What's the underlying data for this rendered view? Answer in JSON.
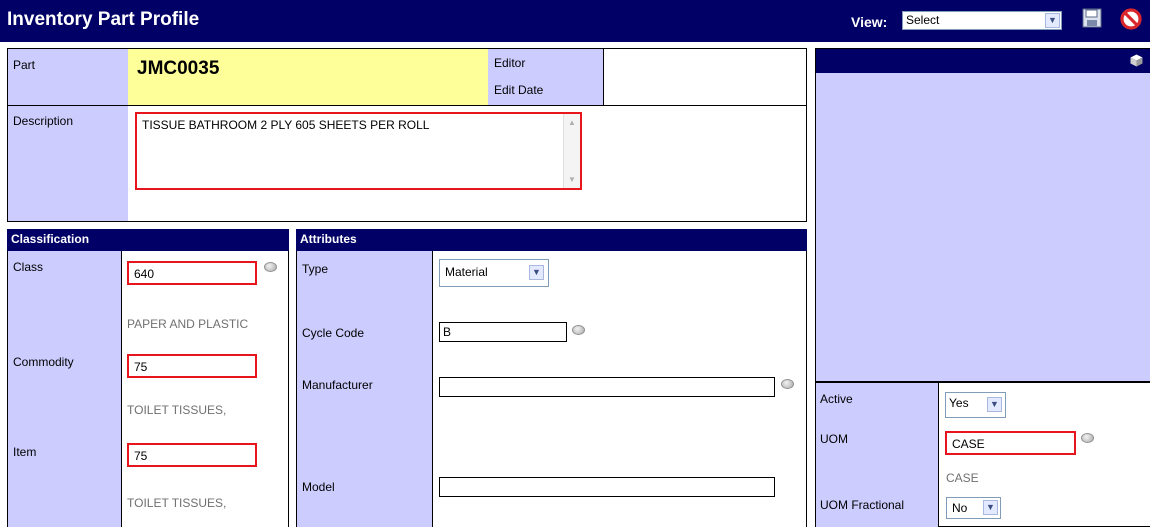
{
  "header": {
    "title": "Inventory Part Profile",
    "view_label": "View:",
    "view_value": "Select",
    "save_icon": "save-icon",
    "cancel_icon": "cancel-icon"
  },
  "part": {
    "part_label": "Part",
    "part_value": "JMC0035",
    "editor_label": "Editor",
    "edit_date_label": "Edit Date",
    "description_label": "Description",
    "description_value": "TISSUE BATHROOM 2 PLY 605 SHEETS PER ROLL"
  },
  "classification": {
    "header": "Classification",
    "class_label": "Class",
    "class_value": "640",
    "class_desc": "PAPER AND PLASTIC",
    "commodity_label": "Commodity",
    "commodity_value": "75",
    "commodity_desc": "TOILET TISSUES,",
    "item_label": "Item",
    "item_value": "75",
    "item_desc": "TOILET TISSUES,"
  },
  "attributes": {
    "header": "Attributes",
    "type_label": "Type",
    "type_value": "Material",
    "cycle_code_label": "Cycle Code",
    "cycle_code_value": "B",
    "manufacturer_label": "Manufacturer",
    "manufacturer_value": "",
    "model_label": "Model",
    "model_value": ""
  },
  "status": {
    "active_label": "Active",
    "active_value": "Yes",
    "uom_label": "UOM",
    "uom_value": "CASE",
    "uom_desc": "CASE",
    "uom_fractional_label": "UOM Fractional",
    "uom_fractional_value": "No"
  },
  "colors": {
    "navy": "#000066",
    "lavender": "#ccccff",
    "yellow": "#ffff99",
    "highlight_red": "#e8151c"
  }
}
